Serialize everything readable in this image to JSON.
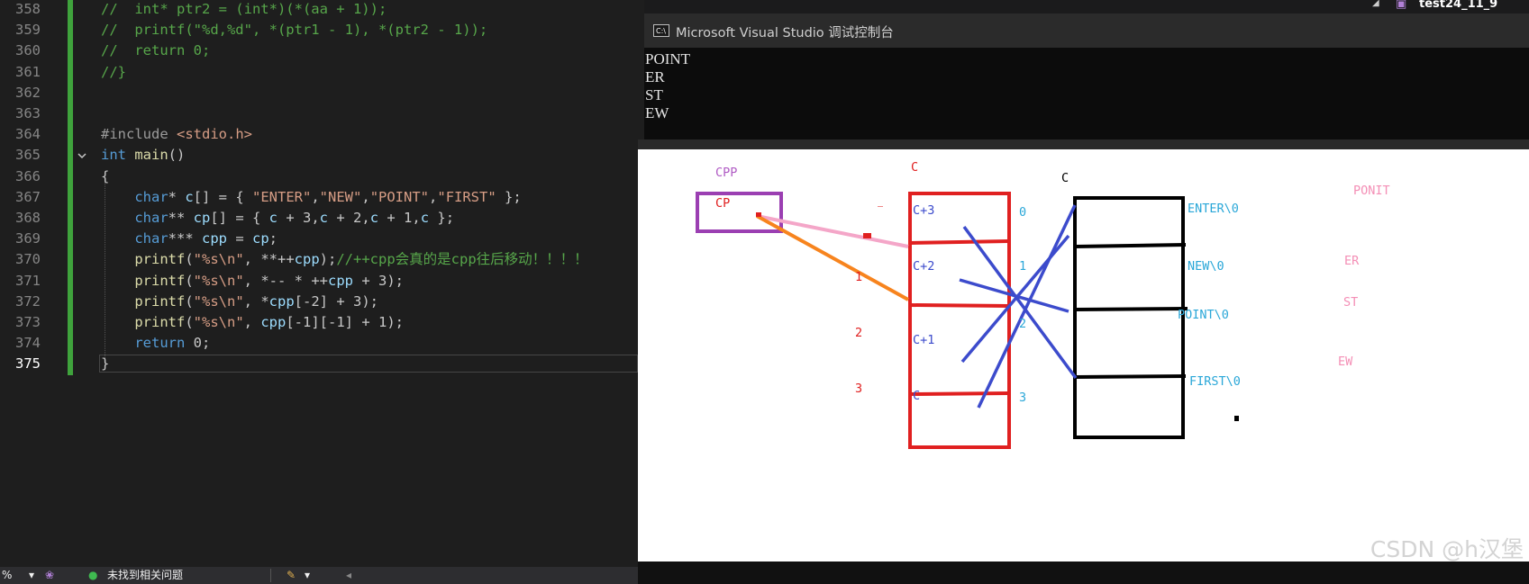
{
  "editor": {
    "line_numbers": [
      "358",
      "359",
      "360",
      "361",
      "362",
      "363",
      "364",
      "365",
      "366",
      "367",
      "368",
      "369",
      "370",
      "371",
      "372",
      "373",
      "374",
      "375"
    ],
    "lines": [
      [
        [
          "t-c",
          "//  int* ptr2 = (int*)(*(aa + 1));"
        ]
      ],
      [
        [
          "t-c",
          "//  printf(\"%d,%d\", *(ptr1 - 1), *(ptr2 - 1));"
        ]
      ],
      [
        [
          "t-c",
          "//  return 0;"
        ]
      ],
      [
        [
          "t-c",
          "//}"
        ]
      ],
      [],
      [],
      [
        [
          "t-p",
          "#include "
        ],
        [
          "t-e",
          "<stdio.h>"
        ]
      ],
      [
        [
          "t-k",
          "int"
        ],
        [
          "t-i",
          " "
        ],
        [
          "t-f",
          "main"
        ],
        [
          "t-i",
          "()"
        ]
      ],
      [
        [
          "t-i",
          "{"
        ]
      ],
      [
        [
          "t-i",
          "    "
        ],
        [
          "t-k",
          "char"
        ],
        [
          "t-i",
          "* "
        ],
        [
          "t-v",
          "c"
        ],
        [
          "t-i",
          "[] = { "
        ],
        [
          "t-s",
          "\"ENTER\""
        ],
        [
          "t-i",
          ","
        ],
        [
          "t-s",
          "\"NEW\""
        ],
        [
          "t-i",
          ","
        ],
        [
          "t-s",
          "\"POINT\""
        ],
        [
          "t-i",
          ","
        ],
        [
          "t-s",
          "\"FIRST\""
        ],
        [
          "t-i",
          " };"
        ]
      ],
      [
        [
          "t-i",
          "    "
        ],
        [
          "t-k",
          "char"
        ],
        [
          "t-i",
          "** "
        ],
        [
          "t-v",
          "cp"
        ],
        [
          "t-i",
          "[] = { "
        ],
        [
          "t-v",
          "c"
        ],
        [
          "t-i",
          " + 3,"
        ],
        [
          "t-v",
          "c"
        ],
        [
          "t-i",
          " + 2,"
        ],
        [
          "t-v",
          "c"
        ],
        [
          "t-i",
          " + 1,"
        ],
        [
          "t-v",
          "c"
        ],
        [
          "t-i",
          " };"
        ]
      ],
      [
        [
          "t-i",
          "    "
        ],
        [
          "t-k",
          "char"
        ],
        [
          "t-i",
          "*** "
        ],
        [
          "t-v",
          "cpp"
        ],
        [
          "t-i",
          " = "
        ],
        [
          "t-v",
          "cp"
        ],
        [
          "t-i",
          ";"
        ]
      ],
      [
        [
          "t-i",
          "    "
        ],
        [
          "t-f",
          "printf"
        ],
        [
          "t-i",
          "("
        ],
        [
          "t-s",
          "\"%s\\n\""
        ],
        [
          "t-i",
          ", **++"
        ],
        [
          "t-v",
          "cpp"
        ],
        [
          "t-i",
          ");"
        ],
        [
          "t-c",
          "//++cpp会真的是cpp往后移动！！！！"
        ]
      ],
      [
        [
          "t-i",
          "    "
        ],
        [
          "t-f",
          "printf"
        ],
        [
          "t-i",
          "("
        ],
        [
          "t-s",
          "\"%s\\n\""
        ],
        [
          "t-i",
          ", *-- * ++"
        ],
        [
          "t-v",
          "cpp"
        ],
        [
          "t-i",
          " + 3);"
        ]
      ],
      [
        [
          "t-i",
          "    "
        ],
        [
          "t-f",
          "printf"
        ],
        [
          "t-i",
          "("
        ],
        [
          "t-s",
          "\"%s\\n\""
        ],
        [
          "t-i",
          ", *"
        ],
        [
          "t-v",
          "cpp"
        ],
        [
          "t-i",
          "[-2] + 3);"
        ]
      ],
      [
        [
          "t-i",
          "    "
        ],
        [
          "t-f",
          "printf"
        ],
        [
          "t-i",
          "("
        ],
        [
          "t-s",
          "\"%s\\n\""
        ],
        [
          "t-i",
          ", "
        ],
        [
          "t-v",
          "cpp"
        ],
        [
          "t-i",
          "[-1][-1] + 1);"
        ]
      ],
      [
        [
          "t-i",
          "    "
        ],
        [
          "t-k",
          "return"
        ],
        [
          "t-i",
          " 0;"
        ]
      ],
      [
        [
          "t-i",
          "}"
        ]
      ]
    ]
  },
  "status_bar": {
    "zoom": "%",
    "issues": "未找到相关问题"
  },
  "console": {
    "title": "Microsoft Visual Studio 调试控制台",
    "output": "POINT\nER\nST\nEW"
  },
  "solution": {
    "project": "test24_11_9"
  },
  "diagram": {
    "cpp_label": "CPP",
    "cp_label": "CP",
    "c_label_red": "C",
    "c_label_black": "C",
    "cp_cells": [
      "C+3",
      "C+2",
      "C+1",
      "C"
    ],
    "cp_left_indices": [
      "1",
      "2",
      "3"
    ],
    "cp_right_indices": [
      "0",
      "1",
      "2",
      "3"
    ],
    "c_cells": [
      "ENTER\\0",
      "NEW\\0",
      "POINT\\0",
      "FIRST\\0"
    ],
    "results": [
      "PONIT",
      "ER",
      "ST",
      "EW"
    ],
    "watermark": "CSDN @h汉堡",
    "colors": {
      "purple": "#9b3fb2",
      "red": "#e02020",
      "blue": "#3c4bcc",
      "cyan": "#2aa7d8",
      "pink": "#f08ab0",
      "orange": "#f7841e"
    }
  }
}
